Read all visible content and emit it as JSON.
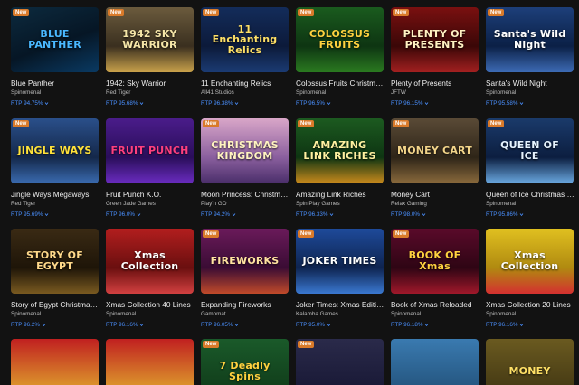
{
  "badge_new": "New",
  "rows": [
    [
      {
        "title": "Blue Panther",
        "provider": "Spinomenal",
        "rtp": "RTP 94.75%",
        "new": true,
        "art": "BLUE PANTHER",
        "bg": "linear-gradient(160deg,#0c2a3e,#061625 55%,#0a3a63)",
        "color": "#4ab8ff"
      },
      {
        "title": "1942: Sky Warrior",
        "provider": "Red Tiger",
        "rtp": "RTP 95.68%",
        "new": true,
        "art": "1942 SKY WARRIOR",
        "bg": "linear-gradient(180deg,#6b5b3d,#3a2f1f 60%,#c9a24b)",
        "color": "#f6e6a8"
      },
      {
        "title": "11 Enchanting Relics",
        "provider": "All41 Studios",
        "rtp": "RTP 96.38%",
        "new": true,
        "art": "11 Enchanting Relics",
        "bg": "linear-gradient(180deg,#132c5a,#0c1a3a 60%,#1b3b73)",
        "color": "#ffe066"
      },
      {
        "title": "Colossus Fruits Christmas ...",
        "provider": "Spinomenal",
        "rtp": "RTP 96.5%",
        "new": true,
        "art": "COLOSSUS FRUITS",
        "bg": "linear-gradient(180deg,#1a5b1e,#0e3512 60%,#2a7a20)",
        "color": "#ffd23f"
      },
      {
        "title": "Plenty of Presents",
        "provider": "JFTW",
        "rtp": "RTP 96.15%",
        "new": true,
        "art": "PLENTY OF PRESENTS",
        "bg": "linear-gradient(180deg,#7a1010,#3a0707 60%,#a32020)",
        "color": "#fff1c2"
      },
      {
        "title": "Santa's Wild Night",
        "provider": "Spinomenal",
        "rtp": "RTP 95.58%",
        "new": true,
        "art": "Santa's Wild Night",
        "bg": "linear-gradient(180deg,#1d3f7a,#0b2046 60%,#3d6bb5)",
        "color": "#ffffff"
      }
    ],
    [
      {
        "title": "Jingle Ways Megaways",
        "provider": "Red Tiger",
        "rtp": "RTP 95.69%",
        "new": true,
        "art": "JINGLE WAYS",
        "bg": "linear-gradient(180deg,#2a4f8a,#14284a 60%,#3a6bb0)",
        "color": "#ffe23a"
      },
      {
        "title": "Fruit Punch K.O.",
        "provider": "Green Jade Games",
        "rtp": "RTP 96.0%",
        "new": false,
        "art": "FRUIT PUNCH",
        "bg": "linear-gradient(180deg,#4a1c8a,#2a0e5a 60%,#6a2cc0)",
        "color": "#ff3f7f"
      },
      {
        "title": "Moon Princess: Christma...",
        "provider": "Play'n GO",
        "rtp": "RTP 94.2%",
        "new": true,
        "art": "CHRISTMAS KINGDOM",
        "bg": "linear-gradient(180deg,#d9a6c8,#8a5f9e 60%,#4a2e6a)",
        "color": "#fff3c0"
      },
      {
        "title": "Amazing Link Riches",
        "provider": "Spin Play Games",
        "rtp": "RTP 96.33%",
        "new": true,
        "art": "AMAZING LINK RICHES",
        "bg": "linear-gradient(180deg,#1c5a20,#0e3512 60%,#c98a1c)",
        "color": "#fff1a0"
      },
      {
        "title": "Money Cart",
        "provider": "Relax Gaming",
        "rtp": "RTP 98.0%",
        "new": true,
        "art": "MONEY CART",
        "bg": "linear-gradient(180deg,#5a4a36,#2e2518 60%,#8a6a3c)",
        "color": "#f3d58a"
      },
      {
        "title": "Queen of Ice Christmas E...",
        "provider": "Spinomenal",
        "rtp": "RTP 95.86%",
        "new": true,
        "art": "QUEEN OF ICE",
        "bg": "linear-gradient(180deg,#1a3a6a,#0c1e40 60%,#6aa8e0)",
        "color": "#e6f4ff"
      }
    ],
    [
      {
        "title": "Story of Egypt Christmas ...",
        "provider": "Spinomenal",
        "rtp": "RTP 96.2%",
        "new": false,
        "art": "STORY OF EGYPT",
        "bg": "linear-gradient(180deg,#3a2a14,#1e1508 60%,#7a5a20)",
        "color": "#ffd98a"
      },
      {
        "title": "Xmas Collection 40 Lines",
        "provider": "Spinomenal",
        "rtp": "RTP 96.16%",
        "new": false,
        "art": "Xmas Collection",
        "bg": "linear-gradient(180deg,#b21e1e,#6a0f0f 60%,#d24040)",
        "color": "#ffffff"
      },
      {
        "title": "Expanding Fireworks",
        "provider": "Gamomat",
        "rtp": "RTP 96.05%",
        "new": true,
        "art": "FIREWORKS",
        "bg": "linear-gradient(180deg,#6a1a5a,#3a0c34 60%,#c04a2a)",
        "color": "#ffe3a0"
      },
      {
        "title": "Joker Times: Xmas Edition",
        "provider": "Kalamba Games",
        "rtp": "RTP 95.0%",
        "new": true,
        "art": "JOKER TIMES",
        "bg": "linear-gradient(180deg,#1e4a9a,#0e2450 60%,#3a78d0)",
        "color": "#ffffff"
      },
      {
        "title": "Book of Xmas Reloaded",
        "provider": "Spinomenal",
        "rtp": "RTP 96.18%",
        "new": true,
        "art": "BOOK OF Xmas",
        "bg": "linear-gradient(180deg,#5a0a2a,#2e0514 60%,#a0182a)",
        "color": "#ffd23f"
      },
      {
        "title": "Xmas Collection 20 Lines",
        "provider": "Spinomenal",
        "rtp": "RTP 96.16%",
        "new": false,
        "art": "Xmas Collection",
        "bg": "linear-gradient(180deg,#e0c020,#b08a10 60%,#d43030)",
        "color": "#ffffff"
      }
    ],
    [
      {
        "title": "",
        "provider": "",
        "rtp": "",
        "new": false,
        "art": "",
        "bg": "linear-gradient(180deg,#c02020,#e6c030)",
        "color": "#ffffff"
      },
      {
        "title": "",
        "provider": "",
        "rtp": "",
        "new": false,
        "art": "",
        "bg": "linear-gradient(180deg,#c02020,#e6c030)",
        "color": "#ffffff"
      },
      {
        "title": "",
        "provider": "",
        "rtp": "",
        "new": true,
        "art": "7 Deadly Spins",
        "bg": "linear-gradient(180deg,#1a5a2a,#0e3516)",
        "color": "#ffd23f"
      },
      {
        "title": "",
        "provider": "",
        "rtp": "",
        "new": true,
        "art": "",
        "bg": "linear-gradient(180deg,#2a2a4a,#141430)",
        "color": "#ffffff"
      },
      {
        "title": "",
        "provider": "",
        "rtp": "",
        "new": false,
        "art": "",
        "bg": "linear-gradient(180deg,#3a7ab0,#1e4a70)",
        "color": "#ffffff"
      },
      {
        "title": "",
        "provider": "",
        "rtp": "",
        "new": false,
        "art": "MONEY",
        "bg": "linear-gradient(180deg,#6a5a20,#3a3010)",
        "color": "#ffe066"
      }
    ]
  ]
}
